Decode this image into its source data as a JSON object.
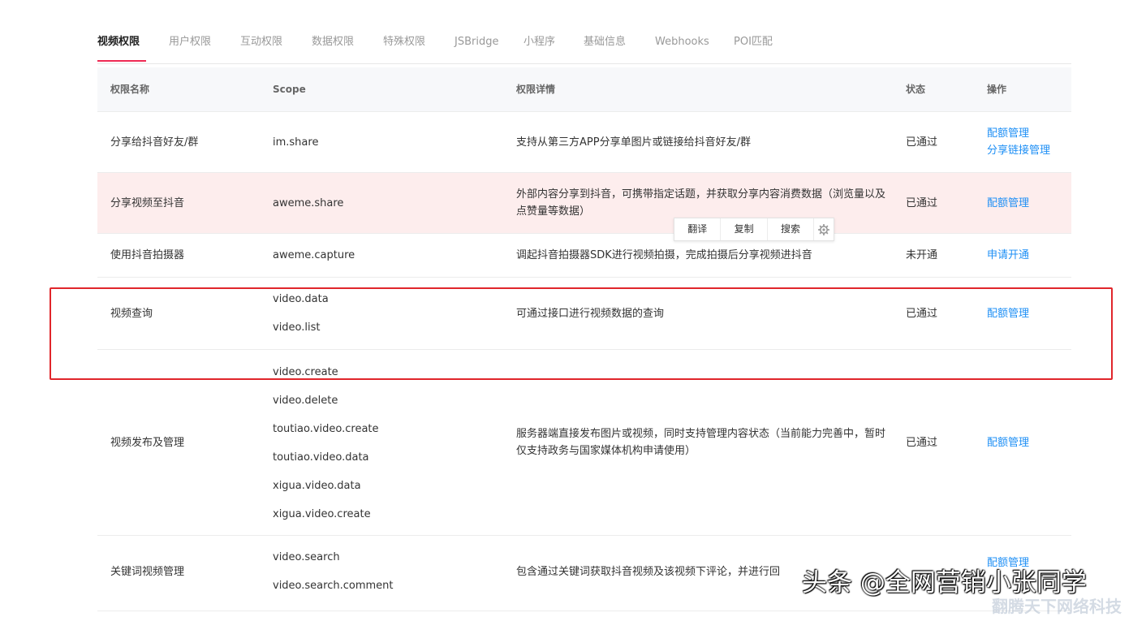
{
  "tabs": [
    {
      "label": "视频权限",
      "active": true
    },
    {
      "label": "用户权限"
    },
    {
      "label": "互动权限"
    },
    {
      "label": "数据权限"
    },
    {
      "label": "特殊权限"
    },
    {
      "label": "JSBridge"
    },
    {
      "label": "小程序"
    },
    {
      "label": "基础信息"
    },
    {
      "label": "Webhooks"
    },
    {
      "label": "POI匹配"
    }
  ],
  "table": {
    "headers": {
      "name": "权限名称",
      "scope": "Scope",
      "detail": "权限详情",
      "status": "状态",
      "ops": "操作"
    },
    "rows": [
      {
        "name": "分享给抖音好友/群",
        "scopes": [
          "im.share"
        ],
        "detail": "支持从第三方APP分享单图片或链接给抖音好友/群",
        "status": "已通过",
        "ops": [
          "配额管理",
          "分享链接管理"
        ]
      },
      {
        "name": "分享视频至抖音",
        "scopes": [
          "aweme.share"
        ],
        "detail": "外部内容分享到抖音，可携带指定话题，并获取分享内容消费数据（浏览量以及点赞量等数据）",
        "status": "已通过",
        "ops": [
          "配额管理"
        ]
      },
      {
        "name": "使用抖音拍摄器",
        "scopes": [
          "aweme.capture"
        ],
        "detail": "调起抖音拍摄器SDK进行视频拍摄，完成拍摄后分享视频进抖音",
        "status": "未开通",
        "ops": [
          "申请开通"
        ]
      },
      {
        "name": "视频查询",
        "scopes": [
          "video.data",
          "video.list"
        ],
        "detail": "可通过接口进行视频数据的查询",
        "status": "已通过",
        "ops": [
          "配额管理"
        ]
      },
      {
        "name": "视频发布及管理",
        "scopes": [
          "video.create",
          "video.delete",
          "toutiao.video.create",
          "toutiao.video.data",
          "xigua.video.data",
          "xigua.video.create"
        ],
        "detail": "服务器端直接发布图片或视频，同时支持管理内容状态（当前能力完善中，暂时仅支持政务与国家媒体机构申请使用）",
        "status": "已通过",
        "ops": [
          "配额管理"
        ]
      },
      {
        "name": "关键词视频管理",
        "scopes": [
          "video.search",
          "video.search.comment"
        ],
        "detail": "包含通过关键词获取抖音视频及该视频下评论，并进行回",
        "status": "",
        "ops": [
          "配额管理"
        ]
      }
    ]
  },
  "popup": {
    "translate": "翻译",
    "copy": "复制",
    "search": "搜索",
    "settings_icon": "gear-icon"
  },
  "watermark": {
    "text": "头条 @全网营销小张同学",
    "sub": "翻腾天下网络科技"
  }
}
